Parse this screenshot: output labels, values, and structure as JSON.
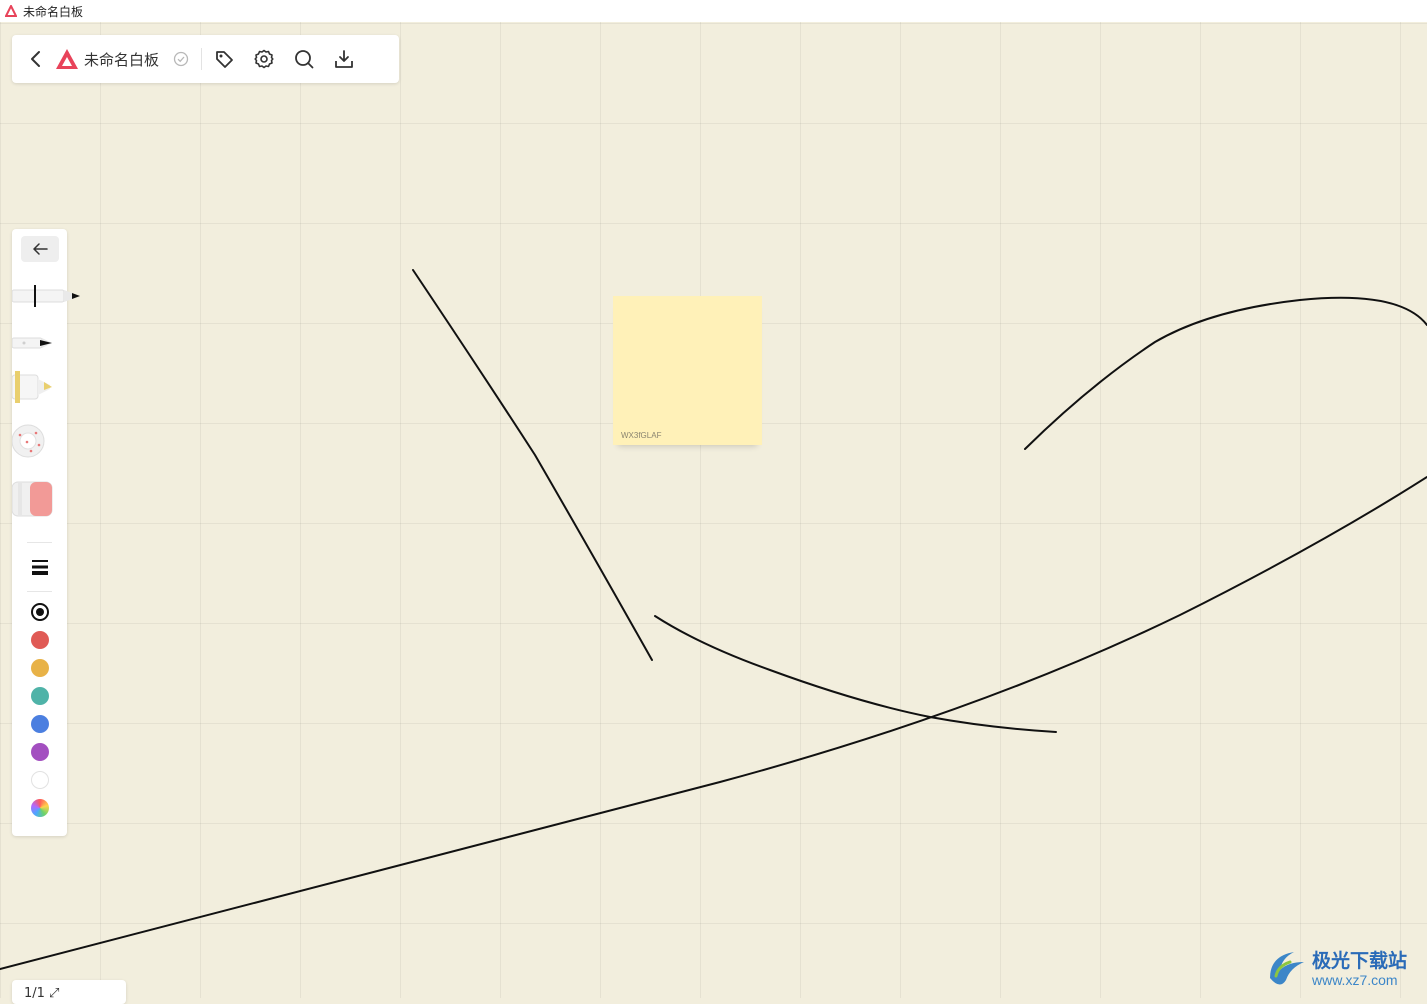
{
  "window": {
    "title": "未命名白板"
  },
  "toolbar": {
    "doc_title": "未命名白板",
    "icons": [
      "back-icon",
      "app-logo-icon",
      "saved-check-icon",
      "tag-icon",
      "settings-icon",
      "search-icon",
      "download-icon"
    ]
  },
  "tools": [
    "pen",
    "fineliner",
    "highlighter",
    "laser",
    "eraser"
  ],
  "colors": {
    "palette": [
      "#111111",
      "#e05a55",
      "#e8b247",
      "#4fb3a8",
      "#4b7fe0",
      "#a34fc0",
      "#ffffff",
      "rainbow"
    ],
    "selected": "#111111",
    "background": "#f2eedd",
    "sticky": "#fff1b8",
    "ink": "#111111"
  },
  "sticky_note": {
    "text": "WX3fGLAF"
  },
  "page_indicator": {
    "text": "1/1 ⤢"
  },
  "watermark": {
    "title": "极光下载站",
    "url": "www.xz7.com"
  }
}
